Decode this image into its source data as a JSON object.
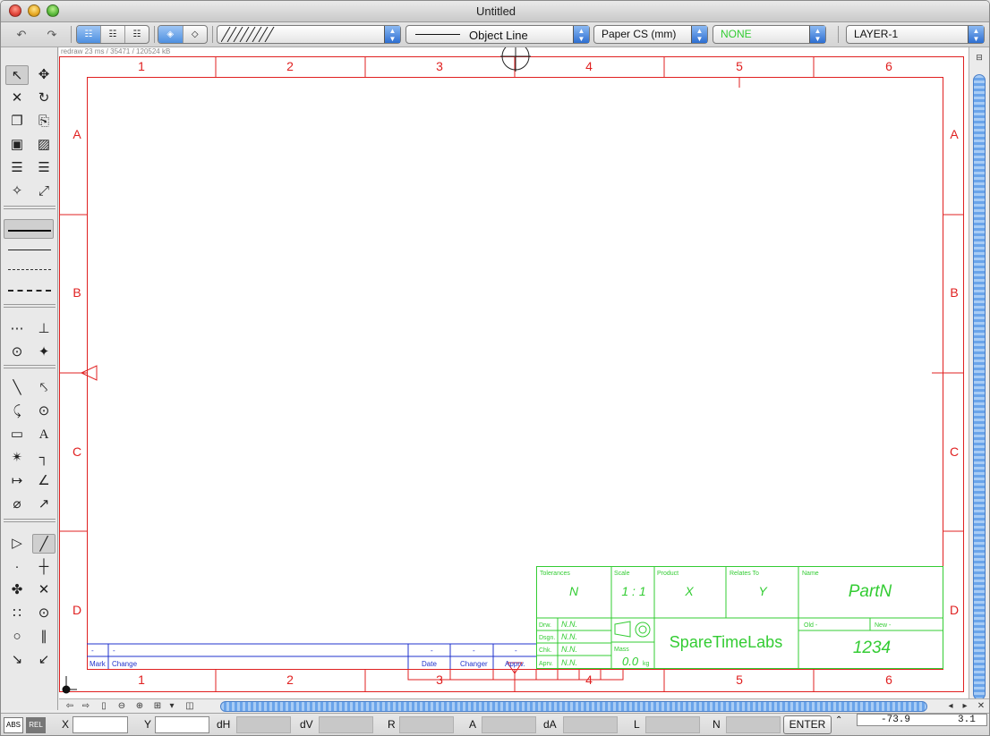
{
  "window": {
    "title": "Untitled"
  },
  "toolbar": {
    "undo_icon": "undo-icon",
    "redo_icon": "redo-icon",
    "hatch_label": "",
    "linetype_label": "Object Line",
    "cs_label": "Paper CS (mm)",
    "color_label": "NONE",
    "color_value": "#33cc33",
    "layer_label": "LAYER-1"
  },
  "status": {
    "redraw": "redraw 23 ms / 35471 / 120524 kB"
  },
  "frame": {
    "col_labels": [
      "1",
      "2",
      "3",
      "4",
      "5",
      "6"
    ],
    "row_labels": [
      "A",
      "B",
      "C",
      "D"
    ]
  },
  "title_block": {
    "tolerances_label": "Tolerances",
    "tolerances_value": "N",
    "scale_label": "Scale",
    "scale_value": "1 : 1",
    "product_label": "Product",
    "product_value": "X",
    "relates_label": "Relates To",
    "relates_value": "Y",
    "name_label": "Name",
    "name_value": "PartN",
    "drw_label": "Drw.",
    "drw_value": "N.N.",
    "dsgn_label": "Dsgn.",
    "dsgn_value": "N.N.",
    "chk_label": "Chk.",
    "chk_value": "N.N.",
    "aprv_label": "Aprv.",
    "aprv_value": "N.N.",
    "mass_label": "Mass",
    "mass_value": "0.0",
    "mass_unit": "kg",
    "company": "SpareTimeLabs",
    "old_label": "Old  -",
    "new_label": "New  -",
    "number": "1234"
  },
  "revision_block": {
    "mark_header": "Mark",
    "change_header": "Change",
    "date_header": "Date",
    "changer_header": "Changer",
    "apprv_header": "Apprv.",
    "dash": "-"
  },
  "inputbar": {
    "abs_label": "ABS",
    "rel_label": "REL",
    "x_label": "X",
    "y_label": "Y",
    "dh_label": "dH",
    "dv_label": "dV",
    "r_label": "R",
    "a_label": "A",
    "da_label": "dA",
    "l_label": "L",
    "n_label": "N",
    "enter_label": "ENTER",
    "coord_x": "-73.9",
    "coord_y": "3.1"
  },
  "colors": {
    "frame": "#e02020",
    "title_block": "#33cc33",
    "revision": "#2233cc",
    "accent": "#4d8fe0"
  }
}
